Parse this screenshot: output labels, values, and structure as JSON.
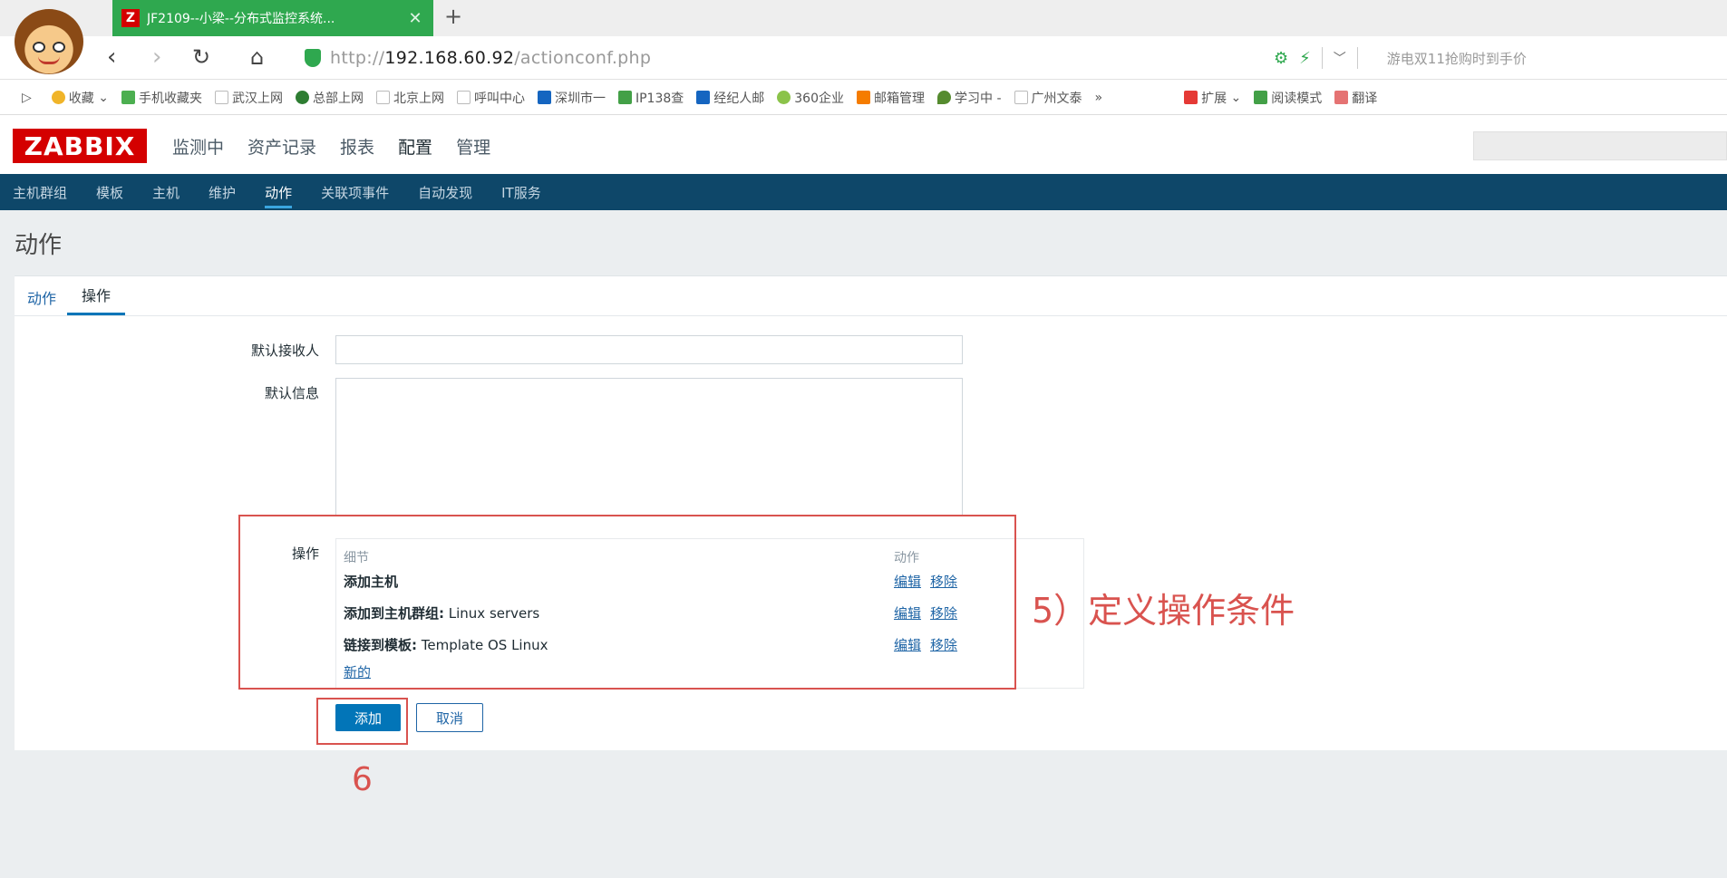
{
  "browser": {
    "tab_title": "JF2109--小梁--分布式监控系统...",
    "tab_close": "✕",
    "new_tab": "+",
    "url_prefix": "http://",
    "url_host": "192.168.60.92",
    "url_path": "/actionconf.php",
    "promo": "游电双11抢购时到手价",
    "bookmarks": [
      {
        "label": "收藏",
        "color": "#f0b429"
      },
      {
        "label": "手机收藏夹",
        "color": "#4caf50"
      },
      {
        "label": "武汉上网",
        "color": "#bbbbbb"
      },
      {
        "label": "总部上网",
        "color": "#2e7d32"
      },
      {
        "label": "北京上网",
        "color": "#bbbbbb"
      },
      {
        "label": "呼叫中心",
        "color": "#bbbbbb"
      },
      {
        "label": "深圳市一",
        "color": "#1565c0"
      },
      {
        "label": "IP138查",
        "color": "#43a047"
      },
      {
        "label": "经纪人邮",
        "color": "#1565c0"
      },
      {
        "label": "360企业",
        "color": "#8bc34a"
      },
      {
        "label": "邮箱管理",
        "color": "#f57c00"
      },
      {
        "label": "学习中 -",
        "color": "#558b2f"
      },
      {
        "label": "广州文泰",
        "color": "#bbbbbb"
      },
      {
        "label": "»",
        "color": ""
      },
      {
        "label": "扩展",
        "color": "#e53935"
      },
      {
        "label": "阅读模式",
        "color": "#43a047"
      },
      {
        "label": "翻译",
        "color": "#e57373"
      }
    ]
  },
  "zabbix": {
    "logo": "ZABBIX",
    "main_menu": [
      "监测中",
      "资产记录",
      "报表",
      "配置",
      "管理"
    ],
    "main_menu_selected": 3,
    "sub_menu": [
      "主机群组",
      "模板",
      "主机",
      "维护",
      "动作",
      "关联项事件",
      "自动发现",
      "IT服务"
    ],
    "sub_menu_selected": 4,
    "page_title": "动作",
    "tabs": [
      "动作",
      "操作"
    ],
    "tab_selected": 1,
    "form": {
      "recipient_label": "默认接收人",
      "recipient_value": "",
      "message_label": "默认信息",
      "message_value": "",
      "operations_label": "操作",
      "ops_header_details": "细节",
      "ops_header_action": "动作",
      "operations": [
        {
          "bold": "添加主机",
          "rest": "",
          "edit": "编辑",
          "remove": "移除"
        },
        {
          "bold": "添加到主机群组:",
          "rest": " Linux servers",
          "edit": "编辑",
          "remove": "移除"
        },
        {
          "bold": "链接到模板:",
          "rest": " Template OS Linux",
          "edit": "编辑",
          "remove": "移除"
        }
      ],
      "new_link": "新的",
      "add_button": "添加",
      "cancel_button": "取消"
    }
  },
  "annotations": {
    "step5": "5）定义操作条件",
    "step6": "6",
    "color": "#d9534f"
  }
}
